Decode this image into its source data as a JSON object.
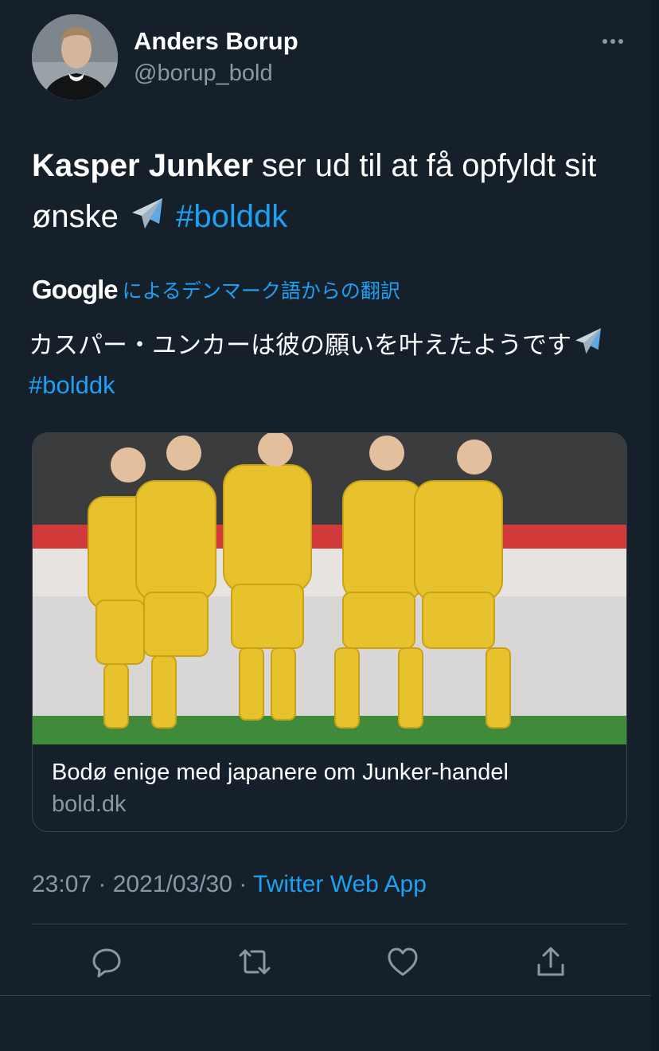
{
  "user": {
    "display_name": "Anders Borup",
    "handle": "@borup_bold"
  },
  "tweet": {
    "bold_name": "Kasper Junker",
    "text_rest": " ser ud til at få opfyldt sit ønske ",
    "emoji_icon": "airplane-icon",
    "hashtag": "#bolddk"
  },
  "translation": {
    "provider": "Google",
    "label": "によるデンマーク語からの翻訳",
    "text": "カスパー・ユンカーは彼の願いを叶えたようです",
    "hashtag": "#bolddk"
  },
  "card": {
    "title": "Bodø enige med japanere om Junker-handel",
    "domain": "bold.dk"
  },
  "meta": {
    "time": "23:07",
    "separator1": " · ",
    "date": "2021/03/30",
    "separator2": " · ",
    "source": "Twitter Web App"
  },
  "colors": {
    "background": "#15202b",
    "accent": "#1da1f2",
    "secondary_text": "#8899a6",
    "border": "#38444d"
  },
  "actions": [
    "reply-icon",
    "retweet-icon",
    "like-icon",
    "share-icon"
  ]
}
